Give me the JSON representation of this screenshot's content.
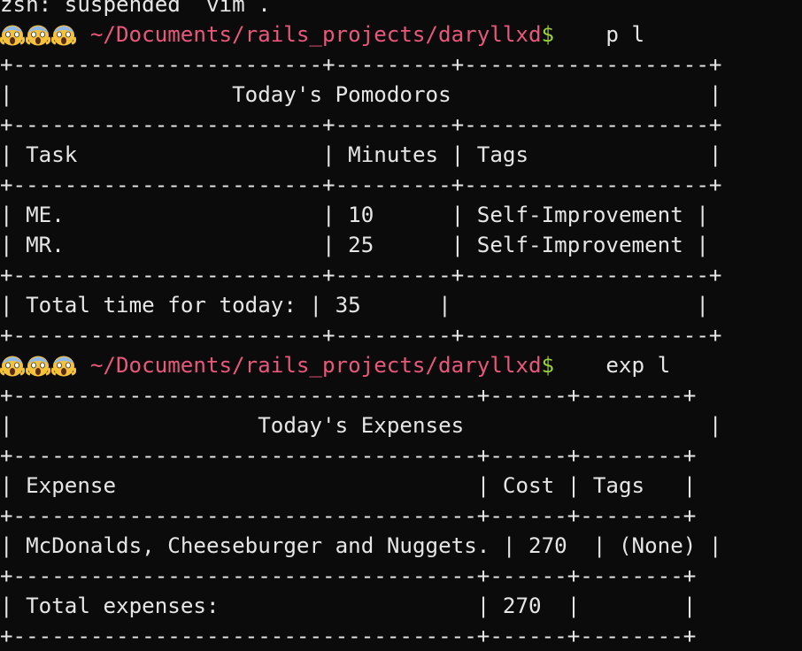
{
  "terminal": {
    "status_line": "zsh: suspended  vim .",
    "prompt_icons": [
      "scream-emoji",
      "scream-emoji",
      "scream-emoji"
    ],
    "prompt_path": " ~/Documents/rails_projects/daryllxd",
    "prompt_symbol": "$",
    "commands": [
      {
        "text": "    p l"
      },
      {
        "text": "    exp l"
      }
    ]
  },
  "pomodoros": {
    "border": "+------------------------+---------+-------------------+",
    "title_row": "|                 Today's Pomodoros                    |",
    "header_row": "| Task                   | Minutes | Tags              |",
    "rows": [
      "| ME.                    | 10      | Self-Improvement |",
      "| MR.                    | 25      | Self-Improvement |"
    ],
    "total_row": "| Total time for today: | 35      |                   |"
  },
  "expenses": {
    "border": "+------------------------------------+------+--------+",
    "title_row": "|                   Today's Expenses                   |",
    "header_row": "| Expense                            | Cost | Tags   |",
    "rows": [
      "| McDonalds, Cheeseburger and Nuggets. | 270  | (None) |"
    ],
    "total_row": "| Total expenses:                    | 270  |        |"
  }
}
